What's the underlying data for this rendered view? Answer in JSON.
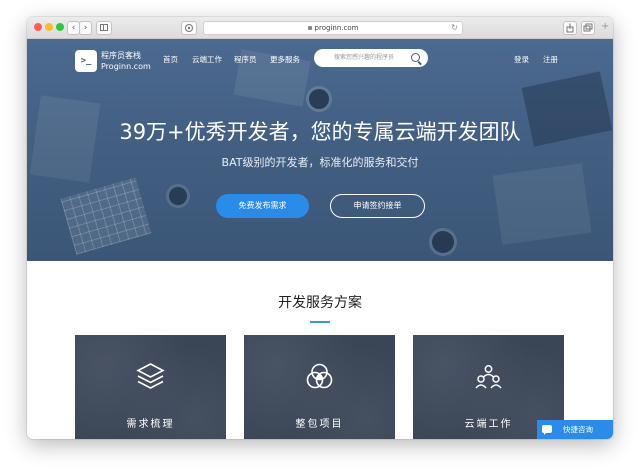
{
  "browser": {
    "url": "proginn.com",
    "back_glyph": "‹",
    "forward_glyph": "›",
    "reload_glyph": "↻",
    "plus_glyph": "+",
    "traffic_lights": {
      "red": "#fc5f57",
      "yellow": "#fdbc2e",
      "green": "#29c840"
    }
  },
  "header": {
    "logo_cn": "程序员客栈",
    "logo_en": "Proginn.com",
    "logo_glyph": ">_",
    "nav": [
      "首页",
      "云端工作",
      "程序员",
      "更多服务"
    ],
    "search_placeholder": "搜索您感兴趣的程序员",
    "login": "登录",
    "register": "注册"
  },
  "hero": {
    "title": "39万+优秀开发者，您的专属云端开发团队",
    "subtitle": "BAT级别的开发者，标准化的服务和交付",
    "primary_button": "免费发布需求",
    "secondary_button": "申请签约接单",
    "background_color": "#4b6a8f",
    "accent_color": "#2a8ce8"
  },
  "section": {
    "title": "开发服务方案",
    "cards": [
      {
        "label": "需求梳理",
        "icon": "layers-icon"
      },
      {
        "label": "整包项目",
        "icon": "venn-icon"
      },
      {
        "label": "云端工作",
        "icon": "team-icon"
      }
    ]
  },
  "consult": {
    "label": "快捷咨询",
    "icon": "chat-icon"
  }
}
